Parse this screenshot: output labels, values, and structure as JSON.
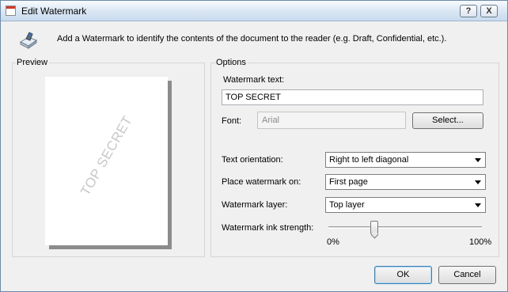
{
  "window": {
    "title": "Edit Watermark",
    "help_label": "?",
    "close_label": "X"
  },
  "intro": {
    "text": "Add a Watermark to identify the contents of the document to the reader (e.g. Draft, Confidential, etc.)."
  },
  "preview": {
    "label": "Preview",
    "watermark_text": "TOP SECRET"
  },
  "options": {
    "label": "Options",
    "watermark_text_label": "Watermark text:",
    "watermark_text_value": "TOP SECRET",
    "font_label": "Font:",
    "font_value": "Arial",
    "select_label": "Select...",
    "orientation_label": "Text orientation:",
    "orientation_value": "Right to left diagonal",
    "place_label": "Place watermark on:",
    "place_value": "First page",
    "layer_label": "Watermark layer:",
    "layer_value": "Top layer",
    "strength_label": "Watermark ink strength:",
    "strength_min": "0%",
    "strength_max": "100%",
    "strength_value": 0.3
  },
  "buttons": {
    "ok": "OK",
    "cancel": "Cancel"
  }
}
